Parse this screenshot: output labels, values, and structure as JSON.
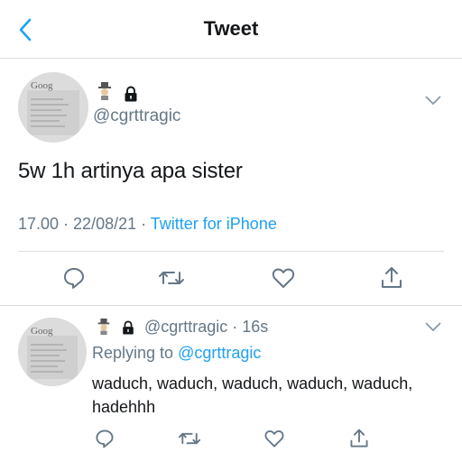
{
  "header": {
    "title": "Tweet",
    "back_icon": "chevron-left-icon"
  },
  "colors": {
    "accent": "#1da1f2",
    "secondary_text": "#657786",
    "primary_text": "#14171a",
    "divider": "#dcdfe3"
  },
  "main_tweet": {
    "avatar_text": "Goog",
    "handle": "@cgrttragic",
    "text": "5w 1h artinya apa sister",
    "timestamp": "17.00 · 22/08/21 · ",
    "source": "Twitter for iPhone",
    "actions": [
      "reply-icon",
      "retweet-icon",
      "like-icon",
      "share-icon"
    ]
  },
  "reply_tweet": {
    "avatar_text": "Goog",
    "handle_time": "@cgrttragic · 16s",
    "replying_prefix": "Replying to ",
    "replying_to": "@cgrttragic",
    "text": "waduch, waduch, waduch, waduch, waduch, hadehhh"
  }
}
